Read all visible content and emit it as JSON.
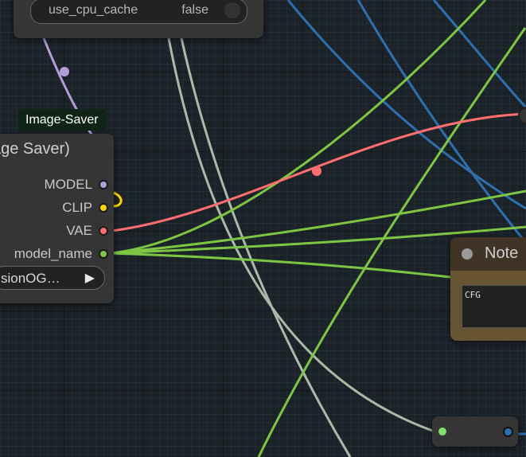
{
  "top_node": {
    "widget_label": "use_cpu_cache",
    "widget_value": "false"
  },
  "image_saver_node": {
    "badge": "Image-Saver",
    "title": "age Saver)",
    "outputs": [
      "MODEL",
      "CLIP",
      "VAE",
      "model_name"
    ],
    "combo_value": "sionOG…",
    "combo_arrow": "▶"
  },
  "note_node": {
    "title": "Note",
    "text": "CFG"
  },
  "slot_colors": {
    "MODEL": "#b39ddb",
    "CLIP": "#ffd500",
    "VAE": "#ff6e6e",
    "model_name": "#7ec544"
  },
  "link_colors": {
    "model": "#b39ddb",
    "clip": "#ffd500",
    "vae": "#ff6e6e",
    "string": "#7ec544",
    "gray": "#a9bba8",
    "blue": "#2e6fb0"
  }
}
